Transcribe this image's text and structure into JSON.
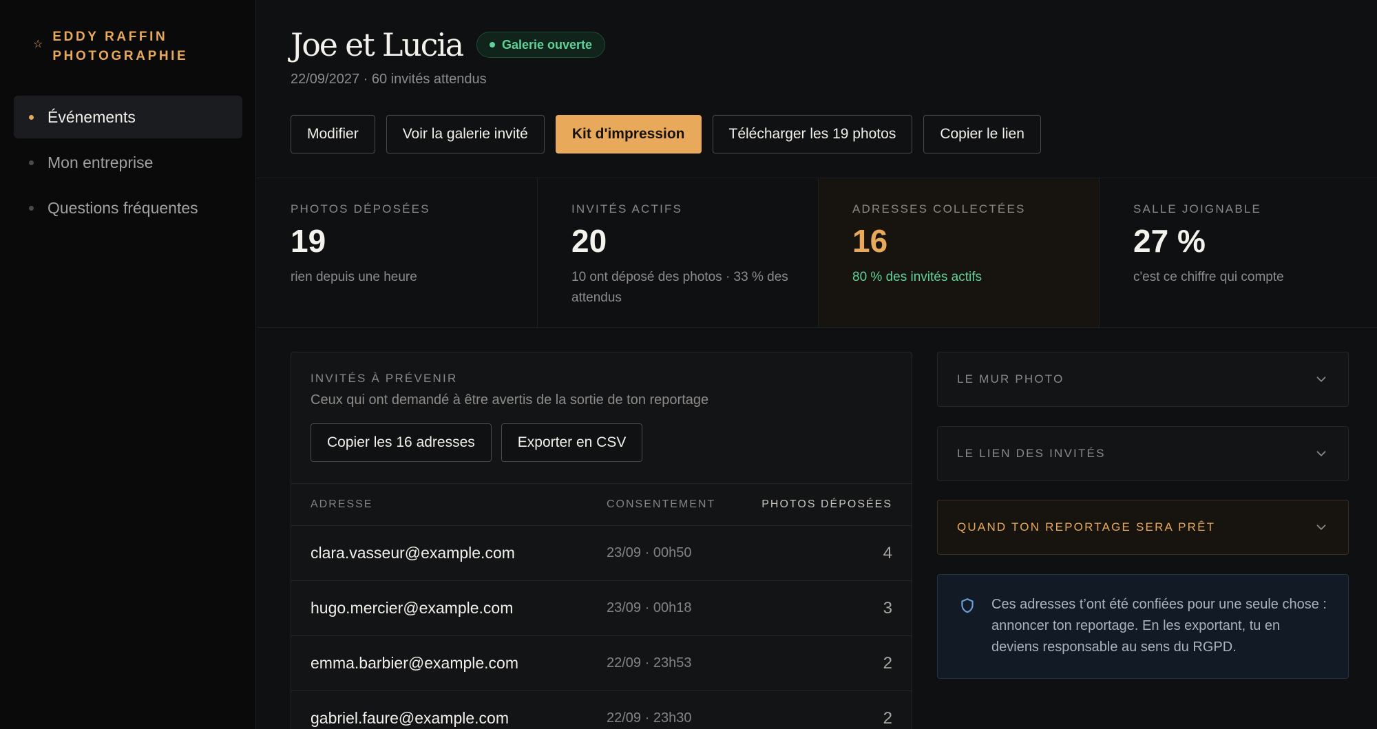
{
  "brand": {
    "name": "EDDY RAFFIN PHOTOGRAPHIE",
    "icon": "star-icon",
    "accent": "#e8a95a"
  },
  "nav": {
    "items": [
      {
        "label": "Événements",
        "active": true
      },
      {
        "label": "Mon entreprise",
        "active": false
      },
      {
        "label": "Questions fréquentes",
        "active": false
      }
    ]
  },
  "event": {
    "title": "Joe et Lucia",
    "badge": "Galerie ouverte",
    "subtitle": "22/09/2027 · 60 invités attendus"
  },
  "actions": {
    "edit": "Modifier",
    "view_gallery": "Voir la galerie invité",
    "print_kit": "Kit d'impression",
    "download": "Télécharger les 19 photos",
    "copy_link": "Copier le lien"
  },
  "stats": [
    {
      "label": "PHOTOS DÉPOSÉES",
      "value": "19",
      "note": "rien depuis une heure"
    },
    {
      "label": "INVITÉS ACTIFS",
      "value": "20",
      "note": "10 ont déposé des photos · 33 % des attendus"
    },
    {
      "label": "ADRESSES COLLECTÉES",
      "value": "16",
      "note": "80 % des invités actifs"
    },
    {
      "label": "SALLE JOIGNABLE",
      "value": "27 %",
      "note": "c'est ce chiffre qui compte"
    }
  ],
  "guests": {
    "title": "INVITÉS À PRÉVENIR",
    "subtitle": "Ceux qui ont demandé à être avertis de la sortie de ton reportage",
    "copy_button": "Copier les 16 adresses",
    "export_button": "Exporter en CSV",
    "columns": [
      "ADRESSE",
      "CONSENTEMENT",
      "PHOTOS DÉPOSÉES"
    ],
    "rows": [
      {
        "address": "clara.vasseur@example.com",
        "consent": "23/09 · 00h50",
        "photos": "4"
      },
      {
        "address": "hugo.mercier@example.com",
        "consent": "23/09 · 00h18",
        "photos": "3"
      },
      {
        "address": "emma.barbier@example.com",
        "consent": "22/09 · 23h53",
        "photos": "2"
      },
      {
        "address": "gabriel.faure@example.com",
        "consent": "22/09 · 23h30",
        "photos": "2"
      }
    ]
  },
  "panels": {
    "photo_wall": "LE MUR PHOTO",
    "guest_link": "LE LIEN DES INVITÉS",
    "report_ready": "QUAND TON REPORTAGE SERA PRÊT"
  },
  "notice": {
    "icon": "shield-icon",
    "text": "Ces adresses t’ont été confiées pour une seule chose : annoncer ton reportage. En les exportant, tu en deviens responsable au sens du RGPD."
  },
  "colors": {
    "accent": "#e8a95a",
    "success": "#5fd29a",
    "info": "#6b9fd6"
  }
}
